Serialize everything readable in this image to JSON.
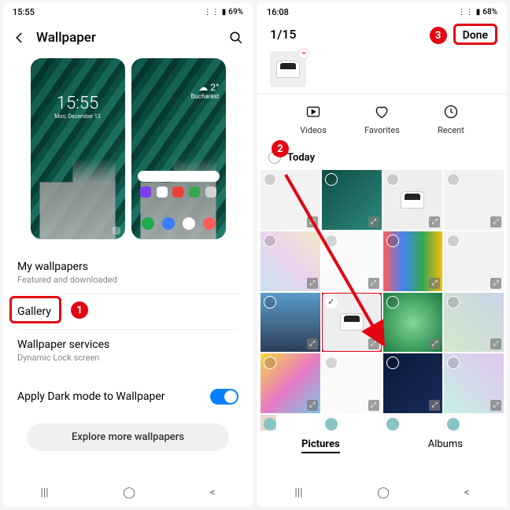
{
  "annotations": {
    "step1": "1",
    "step2": "2",
    "step3": "3"
  },
  "left": {
    "status": {
      "time": "15:55",
      "battery": "69%",
      "icons": "▫ ▪ ⊻ ·"
    },
    "header": {
      "title": "Wallpaper"
    },
    "lock_preview": {
      "time": "15:55",
      "date": "Mon, December 13"
    },
    "home_preview": {
      "weather_temp": "2°",
      "weather_loc": "Bucharest"
    },
    "menu": {
      "my_wallpapers": {
        "title": "My wallpapers",
        "sub": "Featured and downloaded"
      },
      "gallery": {
        "title": "Gallery"
      },
      "services": {
        "title": "Wallpaper services",
        "sub": "Dynamic Lock screen"
      },
      "dark_mode": {
        "title": "Apply Dark mode to Wallpaper"
      },
      "explore": "Explore more wallpapers"
    }
  },
  "right": {
    "status": {
      "time": "16:08",
      "battery": "68%",
      "icons": "▫ ▪ ⊻ ·"
    },
    "selection": {
      "count": "1/15",
      "done": "Done"
    },
    "categories": {
      "videos": "Videos",
      "favorites": "Favorites",
      "recent": "Recent"
    },
    "section": {
      "today": "Today"
    },
    "tabs": {
      "pictures": "Pictures",
      "albums": "Albums"
    }
  },
  "nav": {
    "recents": "|||",
    "home": "◯",
    "back": "<"
  }
}
